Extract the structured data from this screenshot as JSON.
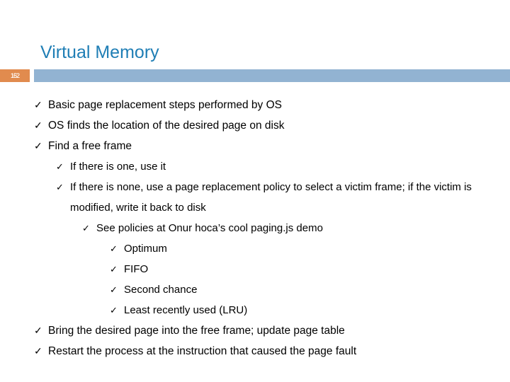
{
  "slide": {
    "title": "Virtual Memory",
    "number": "152",
    "number_overlay": "162",
    "colors": {
      "title": "#1F7EB5",
      "badge": "#E18B4E",
      "rule": "#92B3D2",
      "text": "#000000",
      "background": "#FFFFFF"
    },
    "bullet_glyph": "✓"
  },
  "content": {
    "items": [
      {
        "level": 1,
        "text": "Basic page replacement steps performed by OS"
      },
      {
        "level": 1,
        "text": "OS finds the location of the desired page on disk"
      },
      {
        "level": 1,
        "text": "Find a free frame"
      },
      {
        "level": 2,
        "text": "If there is one, use it"
      },
      {
        "level": 2,
        "text": "If there is none, use a page replacement policy to select a victim frame; if the victim is modified, write it back to disk"
      },
      {
        "level": 3,
        "text": "See policies at Onur hoca’s cool paging.js demo"
      },
      {
        "level": 4,
        "text": "Optimum"
      },
      {
        "level": 4,
        "text": "FIFO"
      },
      {
        "level": 4,
        "text": "Second chance"
      },
      {
        "level": 4,
        "text": "Least recently used (LRU)"
      },
      {
        "level": 1,
        "text": "Bring the desired page into the free frame; update page table"
      },
      {
        "level": 1,
        "text": "Restart the process at the instruction that caused the page fault"
      }
    ]
  }
}
